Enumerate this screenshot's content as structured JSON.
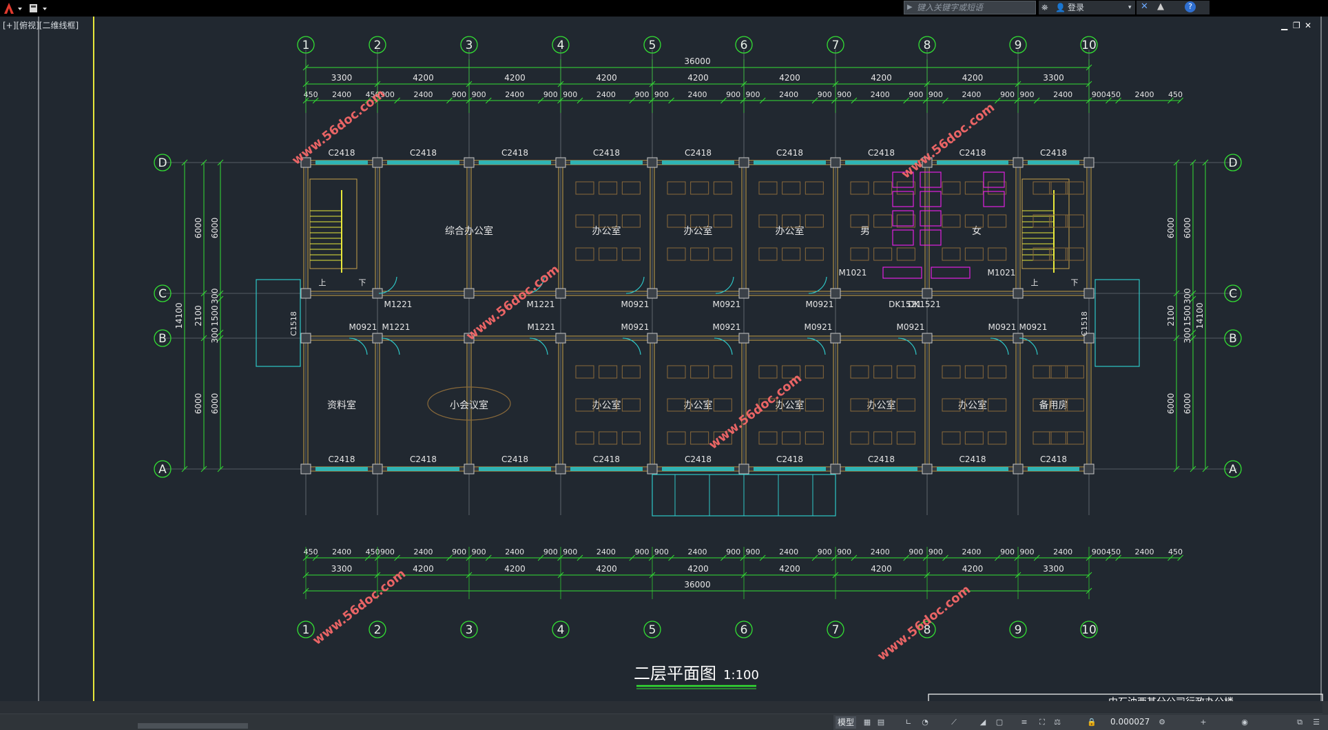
{
  "toolbar": {
    "search_placeholder": "键入关键字或短语",
    "login": "登录"
  },
  "view": {
    "label": "[+][俯视][二维线框]"
  },
  "drawing": {
    "title": "二层平面图",
    "scale": "1:100",
    "axes_top": [
      "1",
      "2",
      "3",
      "4",
      "5",
      "6",
      "7",
      "8",
      "9",
      "10"
    ],
    "axes_left": [
      "D",
      "C",
      "B",
      "A"
    ],
    "total": "36000",
    "bays": [
      "3300",
      "4200",
      "4200",
      "4200",
      "4200",
      "4200",
      "4200",
      "4200",
      "3300"
    ],
    "sub": [
      "450",
      "2400",
      "450",
      "900",
      "2400",
      "900",
      "900",
      "2400",
      "900",
      "900",
      "2400",
      "900",
      "900",
      "2400",
      "900",
      "900",
      "2400",
      "900",
      "900",
      "2400",
      "900",
      "900",
      "2400",
      "900",
      "900",
      "2400",
      "900",
      "450",
      "2400",
      "450"
    ],
    "vdims_outer": "14100",
    "vdims_a": [
      "6000",
      "2100",
      "6000"
    ],
    "vdims_b": [
      "6000",
      "300",
      "1500",
      "300",
      "6000"
    ],
    "windows_top": [
      "C2418",
      "C2418",
      "C2418",
      "C2418",
      "C2418",
      "C2418",
      "C2418",
      "C2418",
      "C2418"
    ],
    "windows_bottom": [
      "C2418",
      "C2418",
      "C2418",
      "C2418",
      "C2418",
      "C2418",
      "C2418",
      "C2418",
      "C2418"
    ],
    "side_window": "C1518",
    "doors_c": [
      "M1221",
      "M1221",
      "M0921",
      "M0921",
      "M0921",
      "DK1521",
      "DK1521"
    ],
    "doors_b": [
      "M0921",
      "M1221",
      "M1221",
      "M0921",
      "M0921",
      "M0921",
      "M0921",
      "M0921",
      "M0921"
    ],
    "toilet_doors": [
      "M1021",
      "M1021"
    ],
    "rooms_top": [
      "综合办公室",
      "办公室",
      "办公室",
      "办公室",
      "男",
      "女"
    ],
    "rooms_bottom": [
      "资料室",
      "小会议室",
      "办公室",
      "办公室",
      "办公室",
      "办公室",
      "办公室",
      "备用房"
    ],
    "stairs": [
      "上",
      "下"
    ],
    "watermark": "www.56doc.com",
    "titleblock": "中石油西某分公司行政办公楼"
  },
  "status": {
    "model": "模型",
    "scale_value": "0.000027"
  }
}
